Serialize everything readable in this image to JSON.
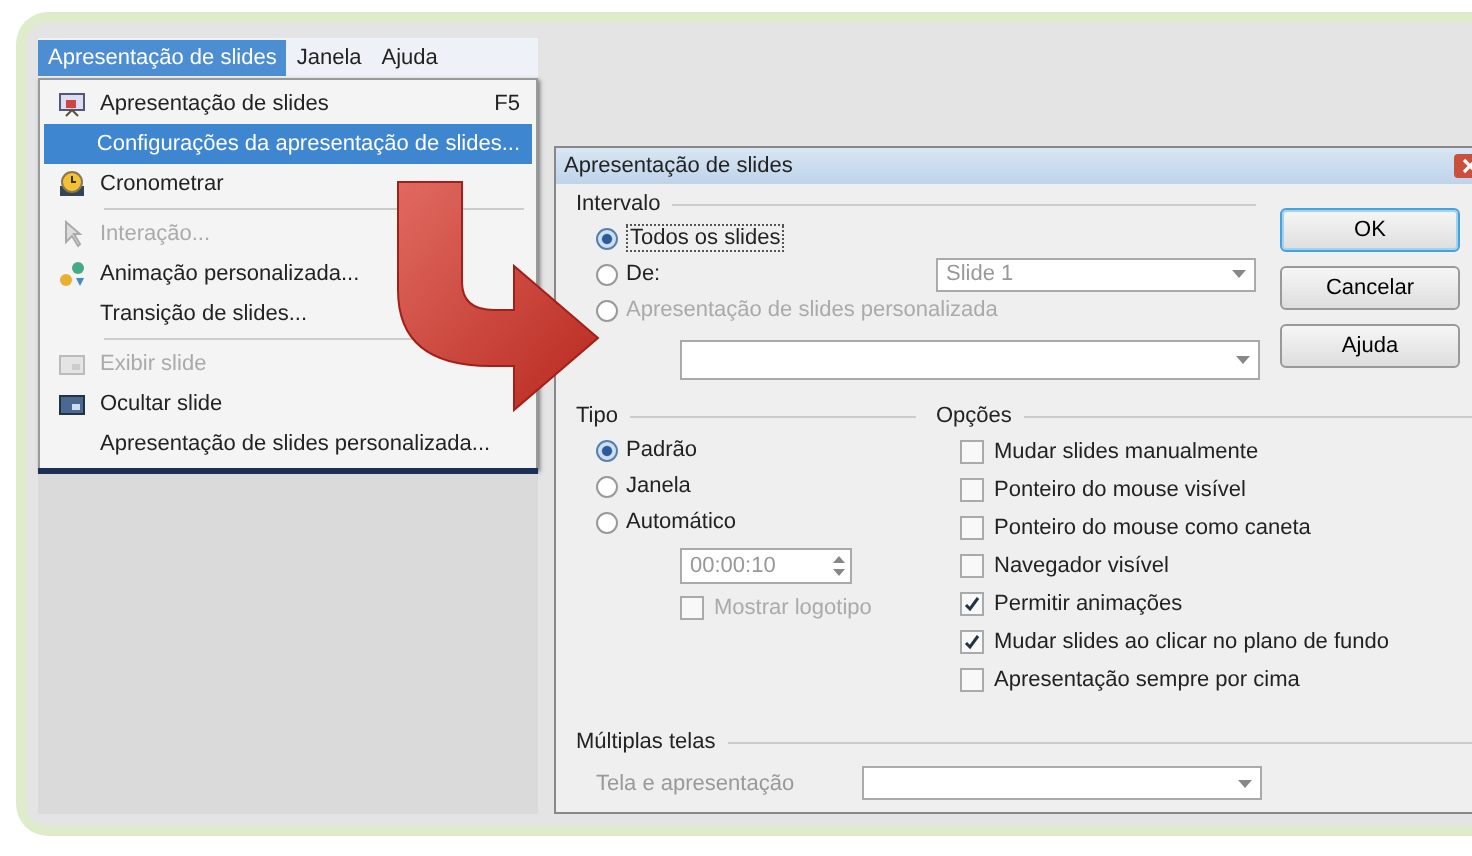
{
  "menubar": [
    {
      "label": "Apresentação de slides",
      "selected": true
    },
    {
      "label": "Janela",
      "selected": false
    },
    {
      "label": "Ajuda",
      "selected": false
    }
  ],
  "menu": [
    {
      "kind": "item",
      "label": "Apresentação de slides",
      "shortcut": "F5",
      "disabled": false,
      "selected": false
    },
    {
      "kind": "item",
      "label": "Configurações da apresentação de slides...",
      "disabled": false,
      "selected": true
    },
    {
      "kind": "item",
      "label": "Cronometrar",
      "disabled": false,
      "selected": false
    },
    {
      "kind": "separator"
    },
    {
      "kind": "item",
      "label": "Interação...",
      "disabled": true,
      "selected": false
    },
    {
      "kind": "item",
      "label": "Animação personalizada...",
      "disabled": false,
      "selected": false
    },
    {
      "kind": "item",
      "label": "Transição de slides...",
      "disabled": false,
      "selected": false
    },
    {
      "kind": "separator"
    },
    {
      "kind": "item",
      "label": "Exibir slide",
      "disabled": true,
      "selected": false
    },
    {
      "kind": "item",
      "label": "Ocultar slide",
      "disabled": false,
      "selected": false
    },
    {
      "kind": "item",
      "label": "Apresentação de slides personalizada...",
      "disabled": false,
      "selected": false
    }
  ],
  "dialog": {
    "title": "Apresentação de slides",
    "range": {
      "label": "Intervalo",
      "options": [
        {
          "label": "Todos os slides",
          "selected": true,
          "disabled": false
        },
        {
          "label": "De:",
          "selected": false,
          "disabled": false
        },
        {
          "label": "Apresentação de slides personalizada",
          "selected": false,
          "disabled": true
        }
      ],
      "from_value": "Slide 1"
    },
    "buttons": [
      {
        "label": "OK",
        "default": true
      },
      {
        "label": "Cancelar",
        "default": false
      },
      {
        "label": "Ajuda",
        "default": false
      }
    ],
    "type": {
      "label": "Tipo",
      "options": [
        {
          "label": "Padrão",
          "selected": true
        },
        {
          "label": "Janela",
          "selected": false
        },
        {
          "label": "Automático",
          "selected": false
        }
      ],
      "time_value": "00:00:10",
      "logo": {
        "label": "Mostrar logotipo",
        "checked": false,
        "disabled": true
      }
    },
    "options": {
      "label": "Opções",
      "items": [
        {
          "label": "Mudar slides manualmente",
          "checked": false
        },
        {
          "label": "Ponteiro do mouse visível",
          "checked": false
        },
        {
          "label": "Ponteiro do mouse como caneta",
          "checked": false
        },
        {
          "label": "Navegador visível",
          "checked": false
        },
        {
          "label": "Permitir animações",
          "checked": true
        },
        {
          "label": "Mudar slides ao clicar no plano de fundo",
          "checked": true
        },
        {
          "label": "Apresentação sempre por cima",
          "checked": false
        }
      ]
    },
    "screens": {
      "label": "Múltiplas telas",
      "field_label": "Tela e apresentação"
    }
  }
}
